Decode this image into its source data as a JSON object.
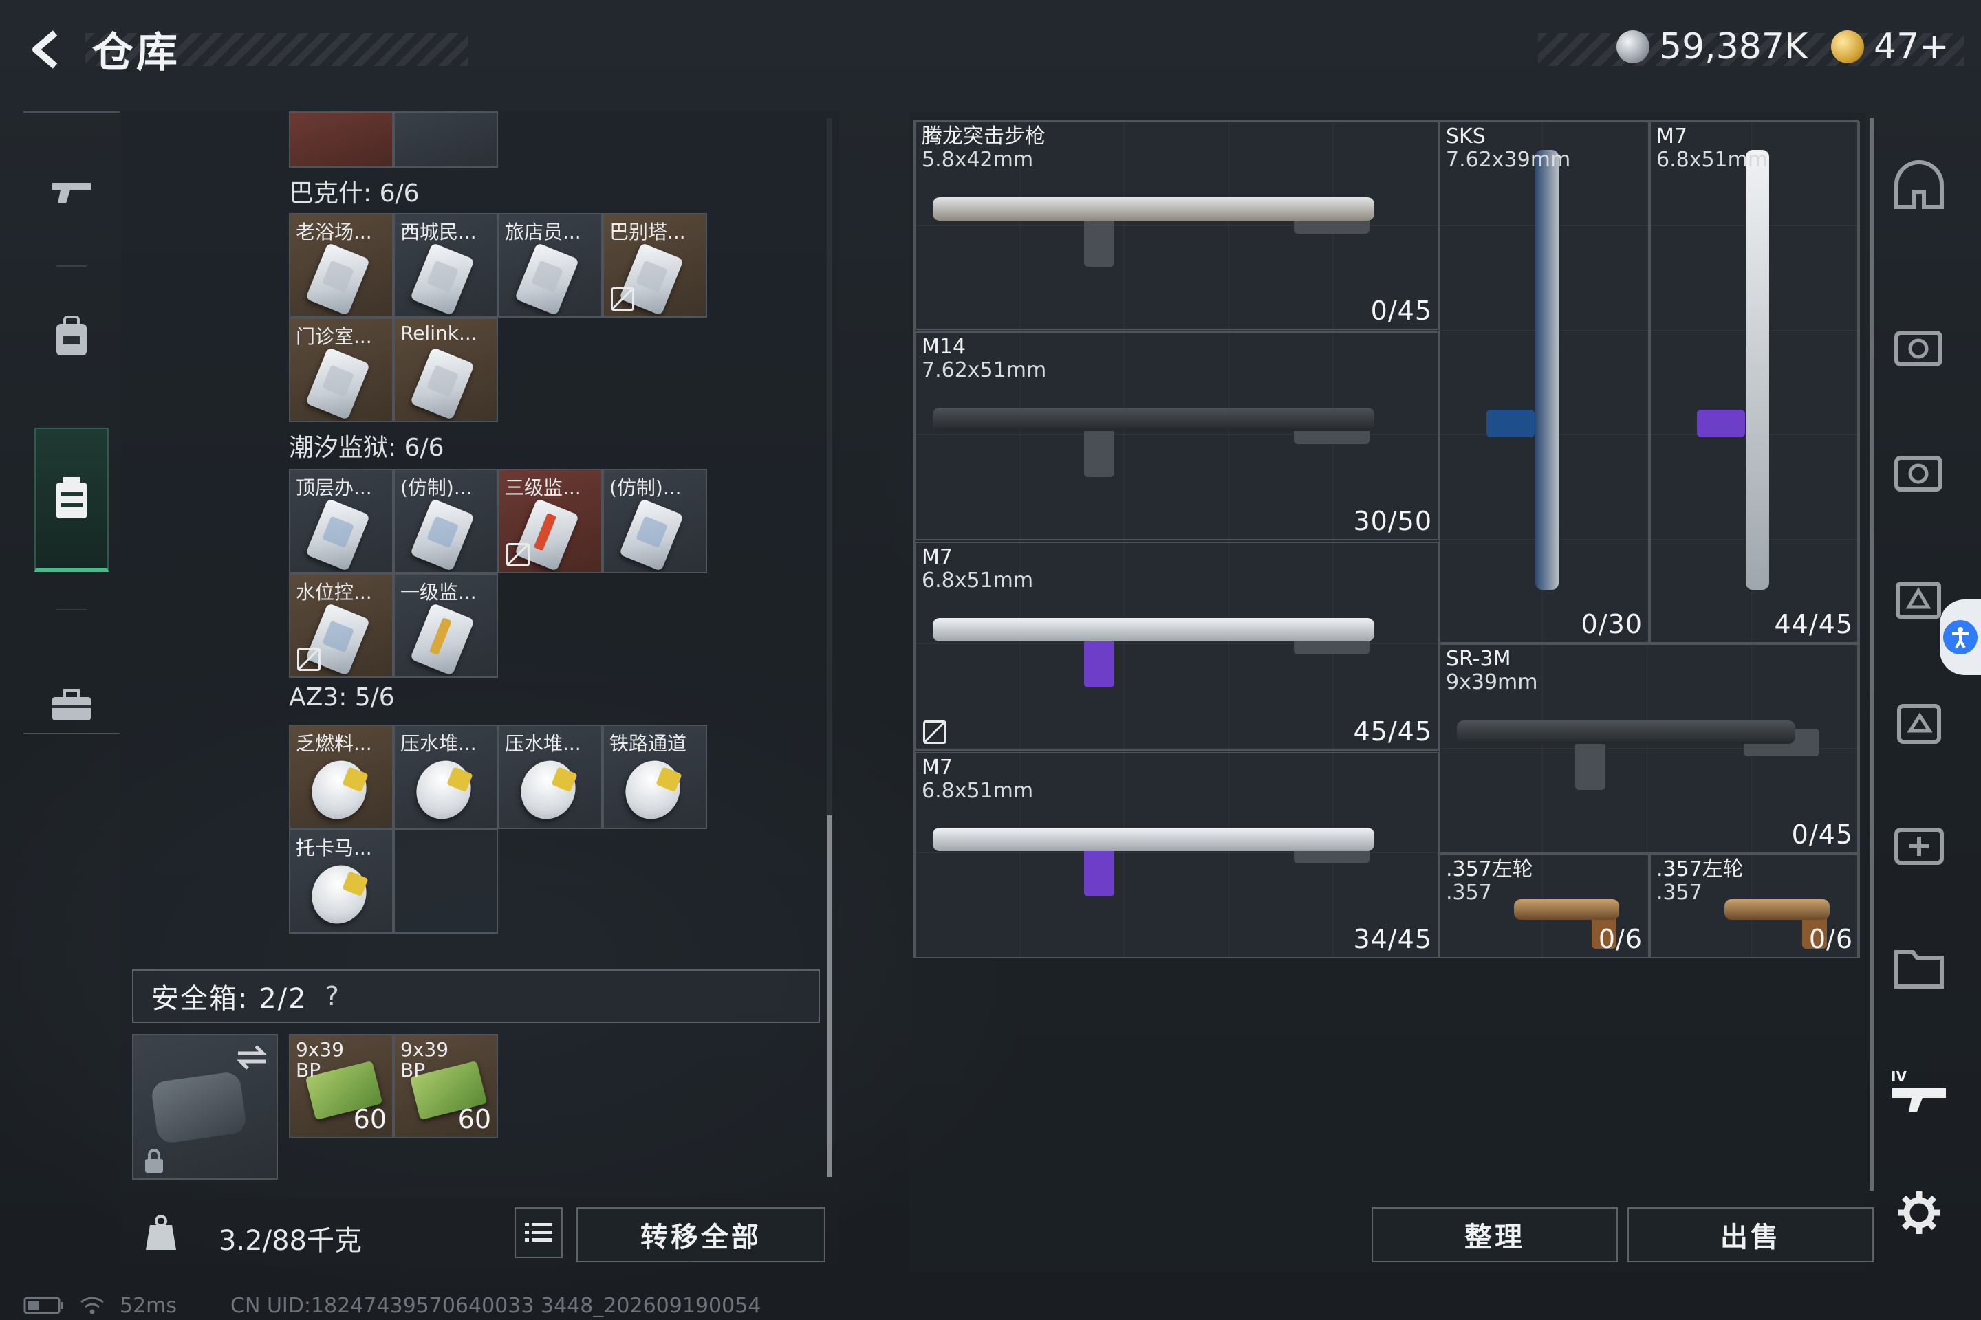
{
  "header": {
    "title": "仓库",
    "currency_primary": "59,387K",
    "currency_secondary": "47+"
  },
  "nav": {
    "items": [
      "gun-icon",
      "backpack-icon",
      "chest-rig-icon",
      "briefcase-icon"
    ],
    "active_index": 2
  },
  "stash": {
    "groups": [
      {
        "label": "巴克什: 6/6",
        "items": [
          {
            "name": "老浴场...",
            "style": "brown",
            "card": "plain"
          },
          {
            "name": "西城民...",
            "style": "gray",
            "card": "plain"
          },
          {
            "name": "旅店员...",
            "style": "gray",
            "card": "plain"
          },
          {
            "name": "巴别塔...",
            "style": "brown",
            "card": "plain",
            "nodrop": true
          },
          {
            "name": "门诊室...",
            "style": "brown",
            "card": "plain"
          },
          {
            "name": "Relink...",
            "style": "brown",
            "card": "plain"
          }
        ]
      },
      {
        "label": "潮汐监狱: 6/6",
        "items": [
          {
            "name": "顶层办...",
            "style": "gray",
            "card": "blue"
          },
          {
            "name": "(仿制)...",
            "style": "gray",
            "card": "blue"
          },
          {
            "name": "三级监...",
            "style": "red",
            "card": "redc",
            "nodrop": true
          },
          {
            "name": "(仿制)...",
            "style": "gray",
            "card": "blue"
          },
          {
            "name": "水位控...",
            "style": "brown",
            "card": "blue",
            "nodrop": true
          },
          {
            "name": "一级监...",
            "style": "gray",
            "card": "gold"
          }
        ]
      },
      {
        "label": "AZ3: 5/6",
        "items": [
          {
            "name": "乏燃料...",
            "style": "brown",
            "card": "egg"
          },
          {
            "name": "压水堆...",
            "style": "gray",
            "card": "egg"
          },
          {
            "name": "压水堆...",
            "style": "gray",
            "card": "egg"
          },
          {
            "name": "铁路通道",
            "style": "gray",
            "card": "egg"
          },
          {
            "name": "托卡马...",
            "style": "gray",
            "card": "egg"
          }
        ]
      }
    ]
  },
  "safebox": {
    "title": "安全箱: 2/2",
    "help": "?",
    "ammo": [
      {
        "line1": "9x39",
        "line2": "BP",
        "count": "60"
      },
      {
        "line1": "9x39",
        "line2": "BP",
        "count": "60"
      }
    ]
  },
  "bottom_left": {
    "weight": "3.2/88千克",
    "transfer_all": "转移全部"
  },
  "status": {
    "ping": "52ms",
    "uid": "CN UID:18247439570640033 3448_202609190054"
  },
  "weapons": [
    {
      "name": "腾龙突击步枪",
      "caliber": "5.8x42mm",
      "ammo": "0/45",
      "kind": "gold"
    },
    {
      "name": "M14",
      "caliber": "7.62x51mm",
      "ammo": "30/50",
      "kind": "dark"
    },
    {
      "name": "M7",
      "caliber": "6.8x51mm",
      "ammo": "45/45",
      "kind": "purple",
      "nodrop": true
    },
    {
      "name": "M7",
      "caliber": "6.8x51mm",
      "ammo": "34/45",
      "kind": "purple"
    },
    {
      "name": "SKS",
      "caliber": "7.62x39mm",
      "ammo": "0/30",
      "kind": "blue"
    },
    {
      "name": "M7",
      "caliber": "6.8x51mm",
      "ammo": "44/45",
      "kind": "purple"
    },
    {
      "name": "SR-3M",
      "caliber": "9x39mm",
      "ammo": "0/45",
      "kind": "dark"
    },
    {
      "name": ".357左轮",
      "caliber": ".357",
      "ammo": "0/6",
      "kind": "revolver"
    },
    {
      "name": ".357左轮",
      "caliber": ".357",
      "ammo": "0/6",
      "kind": "revolver"
    }
  ],
  "actions": {
    "sort": "整理",
    "sell": "出售"
  },
  "colors": {
    "accent_green": "#3fbf8a",
    "weapon_purple": "#6d3fc9",
    "slot_brown": "#5a4a3a",
    "slot_red": "#6b3a33"
  }
}
